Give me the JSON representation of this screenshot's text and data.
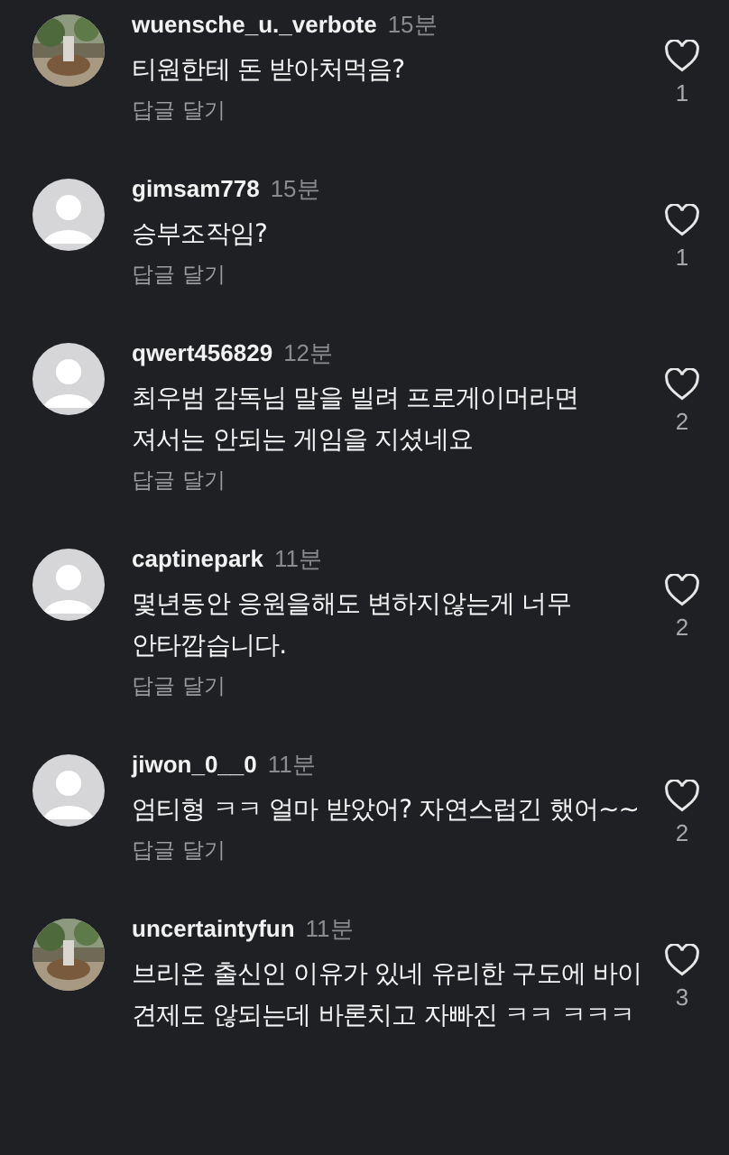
{
  "comments": [
    {
      "kind": "picture",
      "username": "wuensche_u._verbote",
      "time": "15분",
      "text": "티원한테 돈 받아처먹음?",
      "reply": "답글 달기",
      "likes": "1"
    },
    {
      "kind": "default",
      "username": "gimsam778",
      "time": "15분",
      "text": "승부조작임?",
      "reply": "답글 달기",
      "likes": "1"
    },
    {
      "kind": "default",
      "username": "qwert456829",
      "time": "12분",
      "text": "최우범 감독님 말을 빌려 프로게이머라면 져서는 안되는 게임을 지셨네요",
      "reply": "답글 달기",
      "likes": "2"
    },
    {
      "kind": "default",
      "username": "captinepark",
      "time": "11분",
      "text": "몇년동안 응원을해도 변하지않는게 너무 안타깝습니다.",
      "reply": "답글 달기",
      "likes": "2"
    },
    {
      "kind": "default",
      "username": "jiwon_0__0",
      "time": "11분",
      "text": "엄티형 ㅋㅋ 얼마 받았어? 자연스럽긴 했어~~",
      "reply": "답글 달기",
      "likes": "2"
    },
    {
      "kind": "picture",
      "username": "uncertaintyfun",
      "time": "11분",
      "text": "브리온 출신인 이유가 있네 유리한 구도에 바이 견제도 않되는데 바론치고 자빠진 ㅋㅋ ㅋㅋㅋ",
      "likes": "3"
    }
  ]
}
